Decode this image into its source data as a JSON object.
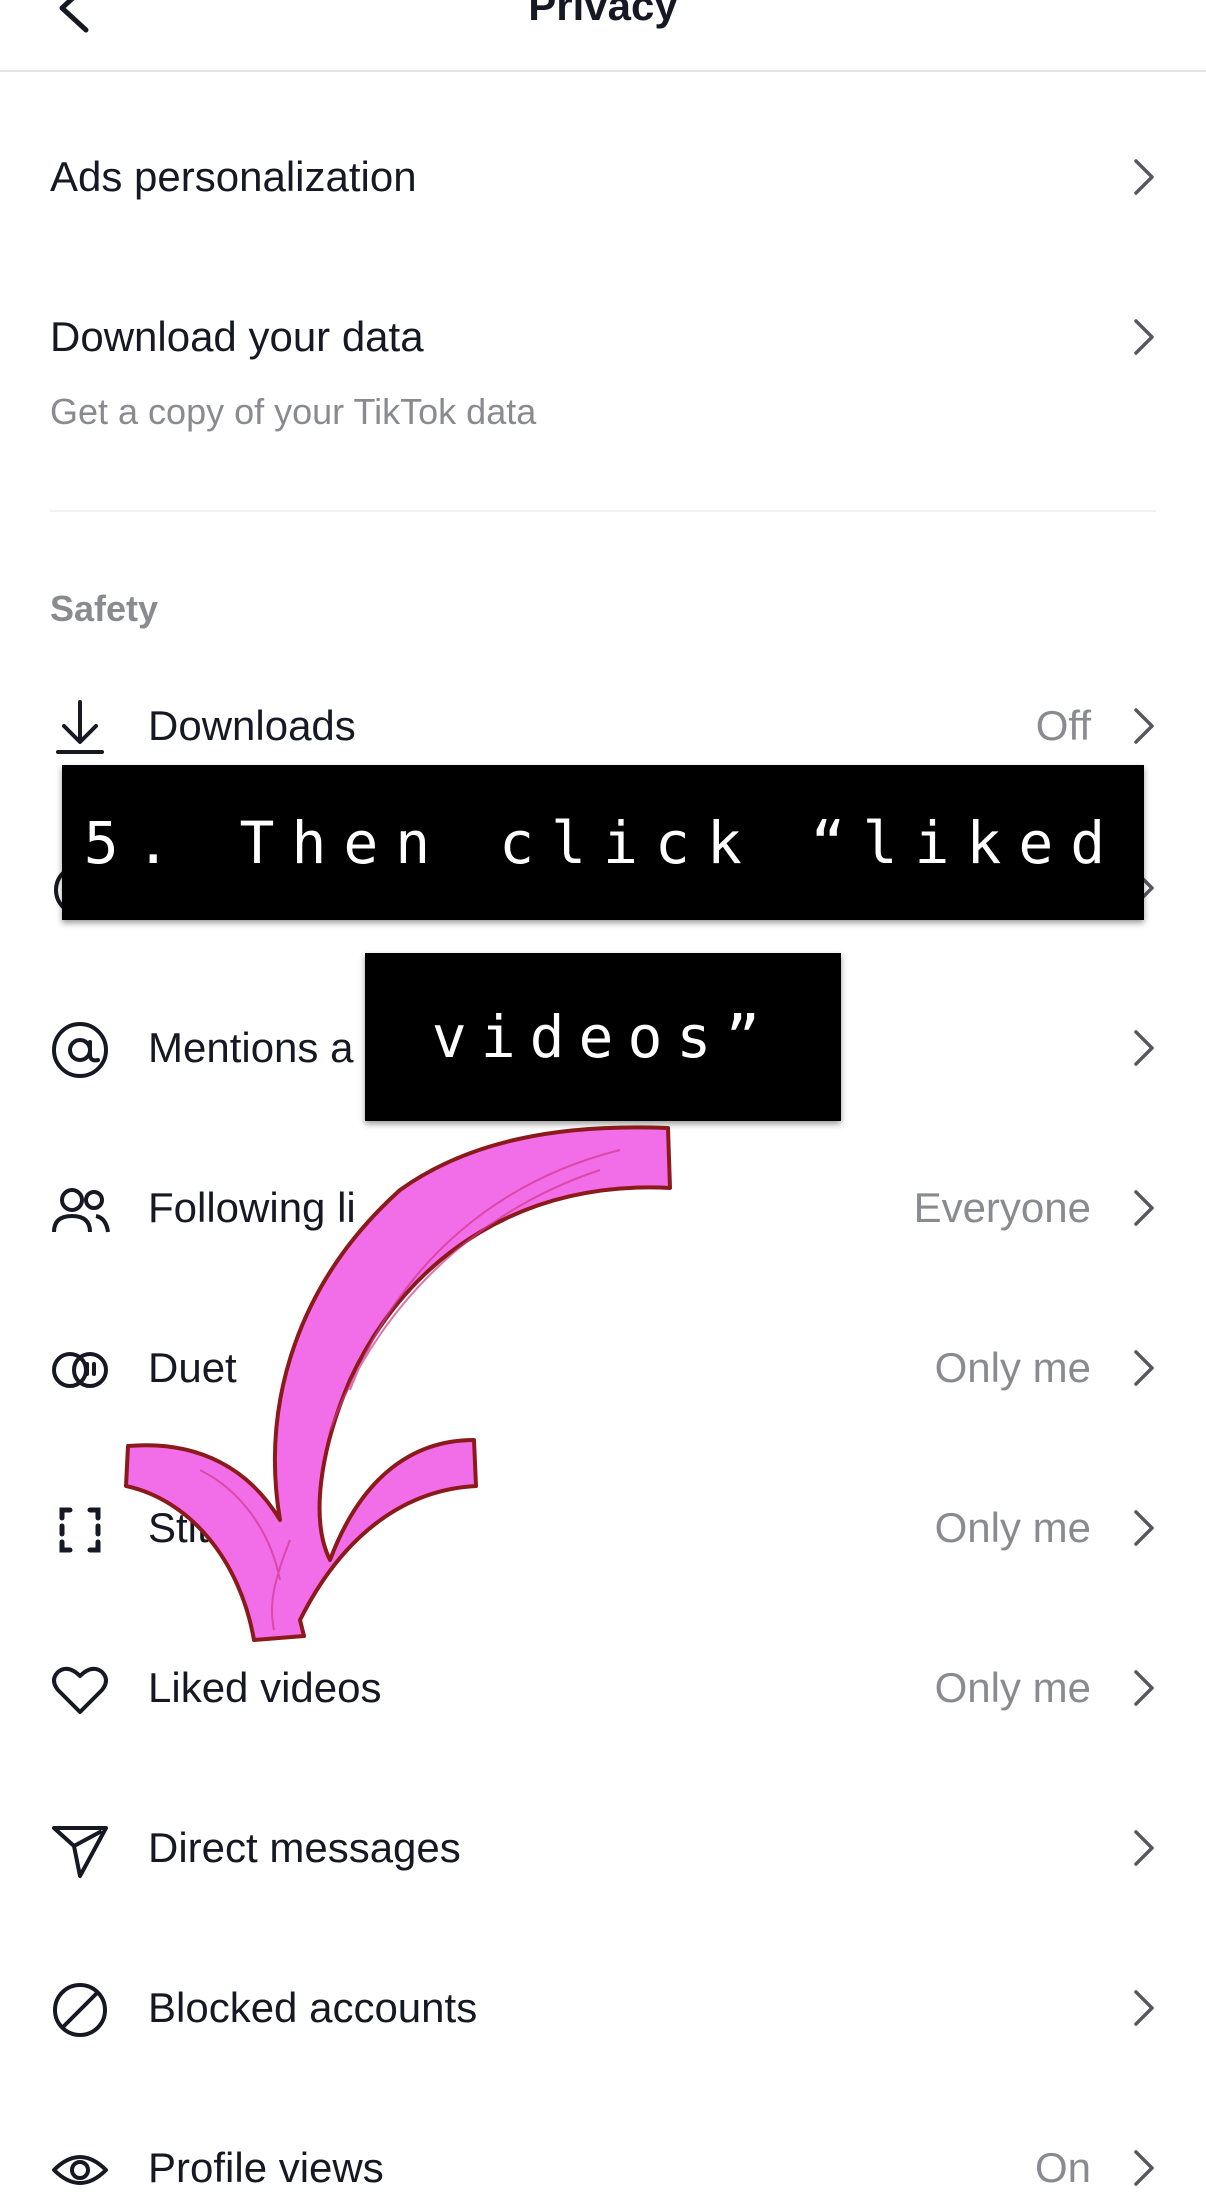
{
  "header": {
    "title": "Privacy"
  },
  "rows": {
    "ads": {
      "label": "Ads personalization"
    },
    "download_data": {
      "label": "Download your data",
      "subtext": "Get a copy of your TikTok data"
    },
    "downloads": {
      "label": "Downloads",
      "value": "Off",
      "icon": "download-icon"
    },
    "mentions": {
      "label": "Mentions a",
      "icon": "at-icon"
    },
    "following": {
      "label": "Following li",
      "value": "Everyone",
      "icon": "people-icon"
    },
    "duet": {
      "label": "Duet",
      "value": "Only me",
      "icon": "duet-icon"
    },
    "stitch": {
      "label": "Stitc",
      "value": "Only me",
      "icon": "stitch-icon"
    },
    "liked": {
      "label": "Liked videos",
      "value": "Only me",
      "icon": "heart-icon"
    },
    "dm": {
      "label": "Direct messages",
      "icon": "send-icon"
    },
    "blocked": {
      "label": "Blocked accounts",
      "icon": "blocked-icon"
    },
    "profile_views": {
      "label": "Profile views",
      "value": "On",
      "icon": "eye-icon"
    }
  },
  "section": {
    "safety": "Safety"
  },
  "overlay": {
    "caption_line1": "5. Then click “liked",
    "caption_line2": "videos”",
    "arrow_color": "#f26ee8",
    "arrow_outline": "#8b1a1a"
  }
}
